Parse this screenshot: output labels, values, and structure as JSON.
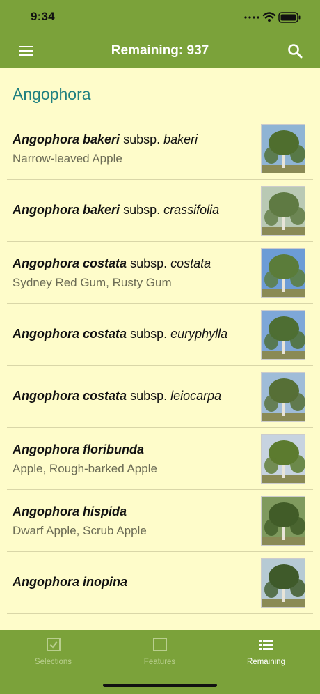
{
  "status": {
    "time": "9:34"
  },
  "nav": {
    "title": "Remaining: 937",
    "menu_icon": "hamburger-menu-icon",
    "search_icon": "search-icon"
  },
  "section": {
    "title": "Angophora"
  },
  "rows": [
    {
      "genus": "Angophora",
      "species": "bakeri",
      "subsp": "bakeri",
      "common": "Narrow-leaved Apple"
    },
    {
      "genus": "Angophora",
      "species": "bakeri",
      "subsp": "crassifolia",
      "common": ""
    },
    {
      "genus": "Angophora",
      "species": "costata",
      "subsp": "costata",
      "common": "Sydney Red Gum, Rusty Gum"
    },
    {
      "genus": "Angophora",
      "species": "costata",
      "subsp": "euryphylla",
      "common": ""
    },
    {
      "genus": "Angophora",
      "species": "costata",
      "subsp": "leiocarpa",
      "common": ""
    },
    {
      "genus": "Angophora",
      "species": "floribunda",
      "subsp": "",
      "common": "Apple, Rough-barked Apple"
    },
    {
      "genus": "Angophora",
      "species": "hispida",
      "subsp": "",
      "common": "Dwarf Apple, Scrub Apple"
    },
    {
      "genus": "Angophora",
      "species": "inopina",
      "subsp": "",
      "common": ""
    }
  ],
  "subsp_label": "subsp.",
  "tabs": [
    {
      "label": "Selections",
      "icon": "checkbox-checked-icon",
      "active": false
    },
    {
      "label": "Features",
      "icon": "checkbox-empty-icon",
      "active": false
    },
    {
      "label": "Remaining",
      "icon": "list-icon",
      "active": true
    }
  ],
  "colors": {
    "bar": "#7BA23A",
    "background": "#FEFCCA",
    "section": "#1F8080"
  }
}
